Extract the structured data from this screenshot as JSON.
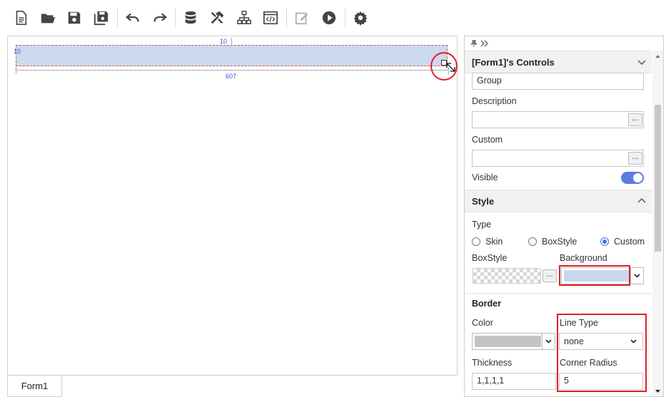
{
  "canvas": {
    "dim_top": "10",
    "dim_left": "10",
    "dim_bottom": "607",
    "tab_label": "Form1"
  },
  "panel": {
    "title": "[Form1]'s Controls",
    "group_value": "Group",
    "description_label": "Description",
    "description_value": "",
    "custom_label": "Custom",
    "custom_value": "",
    "dots": "...",
    "visible_label": "Visible",
    "visible_on": true,
    "style_title": "Style",
    "type_label": "Type",
    "type_options": [
      "Skin",
      "BoxStyle",
      "Custom"
    ],
    "type_selected": "Custom",
    "boxstyle_label": "BoxStyle",
    "background_label": "Background",
    "background_color": "#c9d7ec",
    "border_title": "Border",
    "color_label": "Color",
    "border_color": "#c4c4c4",
    "linetype_label": "Line Type",
    "linetype_value": "none",
    "thickness_label": "Thickness",
    "thickness_value": "1,1,1,1",
    "corner_label": "Corner Radius",
    "corner_value": "5"
  },
  "colors": {
    "highlight": "#e01e2a",
    "toggle": "#5a7be3",
    "radio": "#3a76e6",
    "group_fill": "#cdd9ee"
  }
}
